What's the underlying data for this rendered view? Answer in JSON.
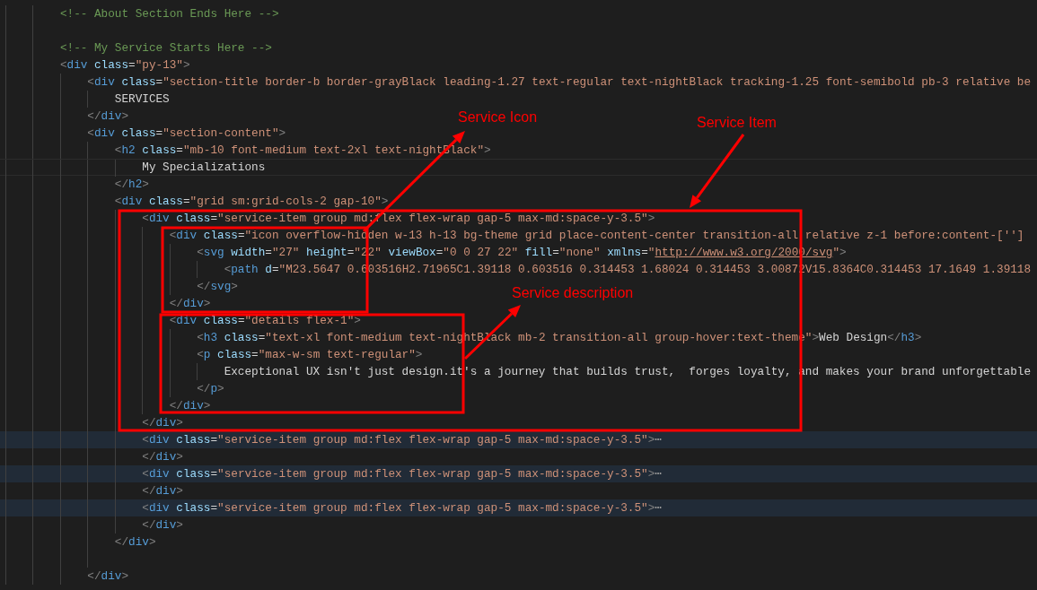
{
  "editor": {
    "lines": [
      {
        "highlighted": false,
        "current": false,
        "tokens": [
          {
            "kind": "comment",
            "text": "<!-- About Section Ends Here -->"
          }
        ]
      },
      {
        "highlighted": false,
        "current": false
      },
      {
        "highlighted": false,
        "current": false,
        "tokens": [
          {
            "kind": "comment",
            "text": "<!-- My Service Starts Here -->"
          }
        ]
      },
      {
        "highlighted": false,
        "current": false,
        "tokens": [
          {
            "kind": "punct",
            "text": "<"
          },
          {
            "kind": "tag",
            "text": "div"
          },
          {
            "kind": "attr",
            "text": " class"
          },
          {
            "kind": "text",
            "text": "="
          },
          {
            "kind": "string",
            "text": "\"py-13\""
          },
          {
            "kind": "punct",
            "text": ">"
          }
        ],
        "children": [
          {
            "highlighted": false,
            "current": false,
            "tokens": [
              {
                "kind": "punct",
                "text": "<"
              },
              {
                "kind": "tag",
                "text": "div"
              },
              {
                "kind": "attr",
                "text": " class"
              },
              {
                "kind": "text",
                "text": "="
              },
              {
                "kind": "string",
                "text": "\"section-title border-b border-grayBlack leading-1.27 text-regular text-nightBlack tracking-1.25 font-semibold pb-3 relative be"
              }
            ],
            "children": [
              {
                "highlighted": false,
                "current": false,
                "tokens": [
                  {
                    "kind": "text",
                    "text": "SERVICES"
                  }
                ]
              }
            ]
          },
          {
            "highlighted": false,
            "current": false,
            "tokens": [
              {
                "kind": "punct",
                "text": "</"
              },
              {
                "kind": "tag",
                "text": "div"
              },
              {
                "kind": "punct",
                "text": ">"
              }
            ]
          },
          {
            "highlighted": false,
            "current": false,
            "tokens": [
              {
                "kind": "punct",
                "text": "<"
              },
              {
                "kind": "tag",
                "text": "div"
              },
              {
                "kind": "attr",
                "text": " class"
              },
              {
                "kind": "text",
                "text": "="
              },
              {
                "kind": "string",
                "text": "\"section-content\""
              },
              {
                "kind": "punct",
                "text": ">"
              }
            ],
            "children": [
              {
                "highlighted": false,
                "current": false,
                "tokens": [
                  {
                    "kind": "punct",
                    "text": "<"
                  },
                  {
                    "kind": "tag",
                    "text": "h2"
                  },
                  {
                    "kind": "attr",
                    "text": " class"
                  },
                  {
                    "kind": "text",
                    "text": "="
                  },
                  {
                    "kind": "string",
                    "text": "\"mb-10 font-medium text-2xl text-nightBlack\""
                  },
                  {
                    "kind": "punct",
                    "text": ">"
                  }
                ],
                "children": [
                  {
                    "highlighted": false,
                    "current": true,
                    "tokens": [
                      {
                        "kind": "text",
                        "text": "My Specializations"
                      }
                    ]
                  }
                ]
              },
              {
                "highlighted": false,
                "current": false,
                "tokens": [
                  {
                    "kind": "punct",
                    "text": "</"
                  },
                  {
                    "kind": "tag",
                    "text": "h2"
                  },
                  {
                    "kind": "punct",
                    "text": ">"
                  }
                ]
              },
              {
                "highlighted": false,
                "current": false,
                "tokens": [
                  {
                    "kind": "punct",
                    "text": "<"
                  },
                  {
                    "kind": "tag",
                    "text": "div"
                  },
                  {
                    "kind": "attr",
                    "text": " class"
                  },
                  {
                    "kind": "text",
                    "text": "="
                  },
                  {
                    "kind": "string",
                    "text": "\"grid sm:grid-cols-2 gap-10\""
                  },
                  {
                    "kind": "punct",
                    "text": ">"
                  }
                ],
                "children": [
                  {
                    "highlighted": false,
                    "current": false,
                    "tokens": [
                      {
                        "kind": "punct",
                        "text": "<"
                      },
                      {
                        "kind": "tag",
                        "text": "div"
                      },
                      {
                        "kind": "attr",
                        "text": " class"
                      },
                      {
                        "kind": "text",
                        "text": "="
                      },
                      {
                        "kind": "string",
                        "text": "\"service-item group md:flex flex-wrap gap-5 max-md:space-y-3.5\""
                      },
                      {
                        "kind": "punct",
                        "text": ">"
                      }
                    ],
                    "children": [
                      {
                        "highlighted": false,
                        "current": false,
                        "tokens": [
                          {
                            "kind": "punct",
                            "text": "<"
                          },
                          {
                            "kind": "tag",
                            "text": "div"
                          },
                          {
                            "kind": "attr",
                            "text": " class"
                          },
                          {
                            "kind": "text",
                            "text": "="
                          },
                          {
                            "kind": "string",
                            "text": "\"icon overflow-hidden w-13 h-13 bg-theme grid place-content-center transition-all relative z-1 before:content-['']"
                          }
                        ],
                        "children": [
                          {
                            "highlighted": false,
                            "current": false,
                            "tokens": [
                              {
                                "kind": "punct",
                                "text": "<"
                              },
                              {
                                "kind": "tag",
                                "text": "svg"
                              },
                              {
                                "kind": "attr",
                                "text": " width"
                              },
                              {
                                "kind": "text",
                                "text": "="
                              },
                              {
                                "kind": "string",
                                "text": "\"27\""
                              },
                              {
                                "kind": "attr",
                                "text": " height"
                              },
                              {
                                "kind": "text",
                                "text": "="
                              },
                              {
                                "kind": "string",
                                "text": "\"22\""
                              },
                              {
                                "kind": "attr",
                                "text": " viewBox"
                              },
                              {
                                "kind": "text",
                                "text": "="
                              },
                              {
                                "kind": "string",
                                "text": "\"0 0 27 22\""
                              },
                              {
                                "kind": "attr",
                                "text": " fill"
                              },
                              {
                                "kind": "text",
                                "text": "="
                              },
                              {
                                "kind": "string",
                                "text": "\"none\""
                              },
                              {
                                "kind": "attr",
                                "text": " xmlns"
                              },
                              {
                                "kind": "text",
                                "text": "="
                              },
                              {
                                "kind": "string",
                                "text": "\""
                              },
                              {
                                "kind": "link",
                                "text": "http://www.w3.org/2000/svg"
                              },
                              {
                                "kind": "string",
                                "text": "\""
                              },
                              {
                                "kind": "punct",
                                "text": ">"
                              }
                            ],
                            "children": [
                              {
                                "highlighted": false,
                                "current": false,
                                "tokens": [
                                  {
                                    "kind": "punct",
                                    "text": "<"
                                  },
                                  {
                                    "kind": "tag",
                                    "text": "path"
                                  },
                                  {
                                    "kind": "attr",
                                    "text": " d"
                                  },
                                  {
                                    "kind": "text",
                                    "text": "="
                                  },
                                  {
                                    "kind": "string",
                                    "text": "\"M23.5647 0.603516H2.71965C1.39118 0.603516 0.314453 1.68024 0.314453 3.00872V15.8364C0.314453 17.1649 1.39118"
                                  }
                                ]
                              }
                            ]
                          },
                          {
                            "highlighted": false,
                            "current": false,
                            "tokens": [
                              {
                                "kind": "punct",
                                "text": "</"
                              },
                              {
                                "kind": "tag",
                                "text": "svg"
                              },
                              {
                                "kind": "punct",
                                "text": ">"
                              }
                            ]
                          }
                        ]
                      },
                      {
                        "highlighted": false,
                        "current": false,
                        "tokens": [
                          {
                            "kind": "punct",
                            "text": "</"
                          },
                          {
                            "kind": "tag",
                            "text": "div"
                          },
                          {
                            "kind": "punct",
                            "text": ">"
                          }
                        ]
                      },
                      {
                        "highlighted": false,
                        "current": false,
                        "tokens": [
                          {
                            "kind": "punct",
                            "text": "<"
                          },
                          {
                            "kind": "tag",
                            "text": "div"
                          },
                          {
                            "kind": "attr",
                            "text": " class"
                          },
                          {
                            "kind": "text",
                            "text": "="
                          },
                          {
                            "kind": "string",
                            "text": "\"details flex-1\""
                          },
                          {
                            "kind": "punct",
                            "text": ">"
                          }
                        ],
                        "children": [
                          {
                            "highlighted": false,
                            "current": false,
                            "tokens": [
                              {
                                "kind": "punct",
                                "text": "<"
                              },
                              {
                                "kind": "tag",
                                "text": "h3"
                              },
                              {
                                "kind": "attr",
                                "text": " class"
                              },
                              {
                                "kind": "text",
                                "text": "="
                              },
                              {
                                "kind": "string",
                                "text": "\"text-xl font-medium text-nightBlack mb-2 transition-all group-hover:text-theme\""
                              },
                              {
                                "kind": "punct",
                                "text": ">"
                              },
                              {
                                "kind": "text",
                                "text": "Web Design"
                              },
                              {
                                "kind": "punct",
                                "text": "</"
                              },
                              {
                                "kind": "tag",
                                "text": "h3"
                              },
                              {
                                "kind": "punct",
                                "text": ">"
                              }
                            ]
                          },
                          {
                            "highlighted": false,
                            "current": false,
                            "tokens": [
                              {
                                "kind": "punct",
                                "text": "<"
                              },
                              {
                                "kind": "tag",
                                "text": "p"
                              },
                              {
                                "kind": "attr",
                                "text": " class"
                              },
                              {
                                "kind": "text",
                                "text": "="
                              },
                              {
                                "kind": "string",
                                "text": "\"max-w-sm text-regular\""
                              },
                              {
                                "kind": "punct",
                                "text": ">"
                              }
                            ],
                            "children": [
                              {
                                "highlighted": false,
                                "current": false,
                                "tokens": [
                                  {
                                    "kind": "text",
                                    "text": "Exceptional UX isn't just design.it's a journey that builds trust,  forges loyalty, and makes your brand unforgettable"
                                  }
                                ]
                              }
                            ]
                          },
                          {
                            "highlighted": false,
                            "current": false,
                            "tokens": [
                              {
                                "kind": "punct",
                                "text": "</"
                              },
                              {
                                "kind": "tag",
                                "text": "p"
                              },
                              {
                                "kind": "punct",
                                "text": ">"
                              }
                            ]
                          }
                        ]
                      },
                      {
                        "highlighted": false,
                        "current": false,
                        "tokens": [
                          {
                            "kind": "punct",
                            "text": "</"
                          },
                          {
                            "kind": "tag",
                            "text": "div"
                          },
                          {
                            "kind": "punct",
                            "text": ">"
                          }
                        ]
                      }
                    ]
                  },
                  {
                    "highlighted": false,
                    "current": false,
                    "tokens": [
                      {
                        "kind": "punct",
                        "text": "</"
                      },
                      {
                        "kind": "tag",
                        "text": "div"
                      },
                      {
                        "kind": "punct",
                        "text": ">"
                      }
                    ]
                  },
                  {
                    "highlighted": true,
                    "current": false,
                    "tokens": [
                      {
                        "kind": "punct",
                        "text": "<"
                      },
                      {
                        "kind": "tag",
                        "text": "div"
                      },
                      {
                        "kind": "attr",
                        "text": " class"
                      },
                      {
                        "kind": "text",
                        "text": "="
                      },
                      {
                        "kind": "string",
                        "text": "\"service-item group md:flex flex-wrap gap-5 max-md:space-y-3.5\""
                      },
                      {
                        "kind": "punct",
                        "text": ">"
                      },
                      {
                        "kind": "fold",
                        "text": "⋯"
                      }
                    ]
                  },
                  {
                    "highlighted": false,
                    "current": false,
                    "tokens": [
                      {
                        "kind": "punct",
                        "text": "</"
                      },
                      {
                        "kind": "tag",
                        "text": "div"
                      },
                      {
                        "kind": "punct",
                        "text": ">"
                      }
                    ]
                  },
                  {
                    "highlighted": true,
                    "current": false,
                    "tokens": [
                      {
                        "kind": "punct",
                        "text": "<"
                      },
                      {
                        "kind": "tag",
                        "text": "div"
                      },
                      {
                        "kind": "attr",
                        "text": " class"
                      },
                      {
                        "kind": "text",
                        "text": "="
                      },
                      {
                        "kind": "string",
                        "text": "\"service-item group md:flex flex-wrap gap-5 max-md:space-y-3.5\""
                      },
                      {
                        "kind": "punct",
                        "text": ">"
                      },
                      {
                        "kind": "fold",
                        "text": "⋯"
                      }
                    ]
                  },
                  {
                    "highlighted": false,
                    "current": false,
                    "tokens": [
                      {
                        "kind": "punct",
                        "text": "</"
                      },
                      {
                        "kind": "tag",
                        "text": "div"
                      },
                      {
                        "kind": "punct",
                        "text": ">"
                      }
                    ]
                  },
                  {
                    "highlighted": true,
                    "current": false,
                    "tokens": [
                      {
                        "kind": "punct",
                        "text": "<"
                      },
                      {
                        "kind": "tag",
                        "text": "div"
                      },
                      {
                        "kind": "attr",
                        "text": " class"
                      },
                      {
                        "kind": "text",
                        "text": "="
                      },
                      {
                        "kind": "string",
                        "text": "\"service-item group md:flex flex-wrap gap-5 max-md:space-y-3.5\""
                      },
                      {
                        "kind": "punct",
                        "text": ">"
                      },
                      {
                        "kind": "fold",
                        "text": "⋯"
                      }
                    ]
                  },
                  {
                    "highlighted": false,
                    "current": false,
                    "tokens": [
                      {
                        "kind": "punct",
                        "text": "</"
                      },
                      {
                        "kind": "tag",
                        "text": "div"
                      },
                      {
                        "kind": "punct",
                        "text": ">"
                      }
                    ]
                  }
                ]
              },
              {
                "highlighted": false,
                "current": false,
                "tokens": [
                  {
                    "kind": "punct",
                    "text": "</"
                  },
                  {
                    "kind": "tag",
                    "text": "div"
                  },
                  {
                    "kind": "punct",
                    "text": ">"
                  }
                ]
              },
              {
                "highlighted": false,
                "current": false
              }
            ]
          },
          {
            "highlighted": false,
            "current": false,
            "tokens": [
              {
                "kind": "punct",
                "text": "</"
              },
              {
                "kind": "tag",
                "text": "div"
              },
              {
                "kind": "punct",
                "text": ">"
              }
            ]
          }
        ]
      }
    ]
  },
  "annotations": [
    {
      "label": "Service Icon"
    },
    {
      "label": "Service Item"
    },
    {
      "label": "Service description"
    }
  ]
}
